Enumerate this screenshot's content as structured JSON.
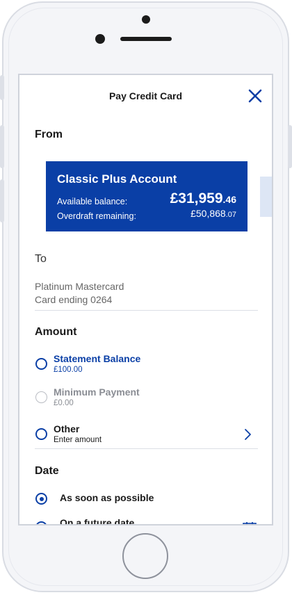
{
  "header": {
    "title": "Pay Credit Card"
  },
  "from": {
    "label": "From",
    "account": {
      "name": "Classic Plus Account",
      "available_label": "Available balance:",
      "available_main": "£31,959",
      "available_pence": ".46",
      "overdraft_label": "Overdraft remaining:",
      "overdraft_main": "£50,868",
      "overdraft_pence": ".07"
    }
  },
  "to": {
    "label": "To",
    "payee": "Platinum Mastercard",
    "card_ending": "Card ending 0264"
  },
  "amount": {
    "label": "Amount",
    "options": [
      {
        "title": "Statement Balance",
        "value": "£100.00"
      },
      {
        "title": "Minimum Payment",
        "value": "£0.00"
      },
      {
        "title": "Other",
        "value": "Enter amount"
      }
    ]
  },
  "date": {
    "label": "Date",
    "options": [
      {
        "title": "As soon as possible",
        "selected": true
      },
      {
        "title": "On a future date",
        "selected": false
      }
    ]
  },
  "colors": {
    "brand_blue": "#0a3fa6",
    "muted_grey": "#8a8d94"
  }
}
